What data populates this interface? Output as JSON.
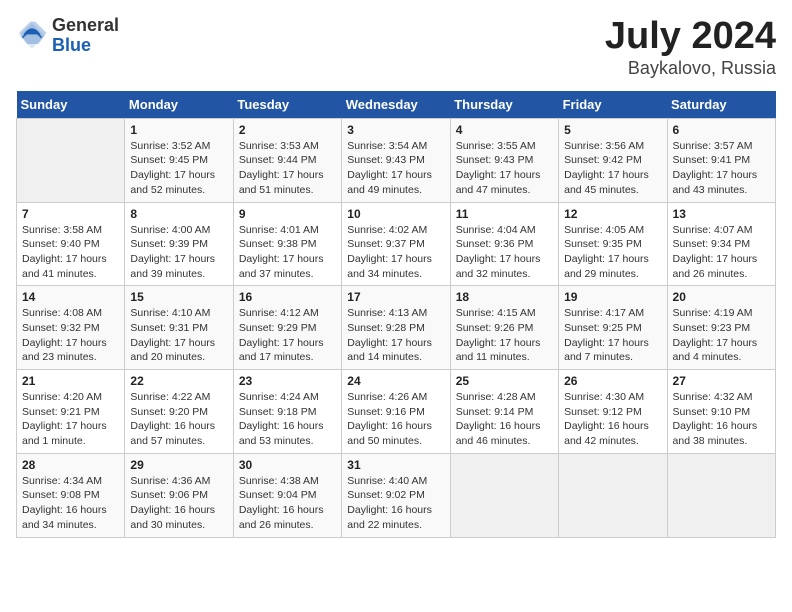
{
  "header": {
    "logo_general": "General",
    "logo_blue": "Blue",
    "month_year": "July 2024",
    "location": "Baykalovo, Russia"
  },
  "days_of_week": [
    "Sunday",
    "Monday",
    "Tuesday",
    "Wednesday",
    "Thursday",
    "Friday",
    "Saturday"
  ],
  "weeks": [
    [
      {
        "empty": true
      },
      {
        "day": "1",
        "sunrise": "Sunrise: 3:52 AM",
        "sunset": "Sunset: 9:45 PM",
        "daylight": "Daylight: 17 hours and 52 minutes."
      },
      {
        "day": "2",
        "sunrise": "Sunrise: 3:53 AM",
        "sunset": "Sunset: 9:44 PM",
        "daylight": "Daylight: 17 hours and 51 minutes."
      },
      {
        "day": "3",
        "sunrise": "Sunrise: 3:54 AM",
        "sunset": "Sunset: 9:43 PM",
        "daylight": "Daylight: 17 hours and 49 minutes."
      },
      {
        "day": "4",
        "sunrise": "Sunrise: 3:55 AM",
        "sunset": "Sunset: 9:43 PM",
        "daylight": "Daylight: 17 hours and 47 minutes."
      },
      {
        "day": "5",
        "sunrise": "Sunrise: 3:56 AM",
        "sunset": "Sunset: 9:42 PM",
        "daylight": "Daylight: 17 hours and 45 minutes."
      },
      {
        "day": "6",
        "sunrise": "Sunrise: 3:57 AM",
        "sunset": "Sunset: 9:41 PM",
        "daylight": "Daylight: 17 hours and 43 minutes."
      }
    ],
    [
      {
        "day": "7",
        "sunrise": "Sunrise: 3:58 AM",
        "sunset": "Sunset: 9:40 PM",
        "daylight": "Daylight: 17 hours and 41 minutes."
      },
      {
        "day": "8",
        "sunrise": "Sunrise: 4:00 AM",
        "sunset": "Sunset: 9:39 PM",
        "daylight": "Daylight: 17 hours and 39 minutes."
      },
      {
        "day": "9",
        "sunrise": "Sunrise: 4:01 AM",
        "sunset": "Sunset: 9:38 PM",
        "daylight": "Daylight: 17 hours and 37 minutes."
      },
      {
        "day": "10",
        "sunrise": "Sunrise: 4:02 AM",
        "sunset": "Sunset: 9:37 PM",
        "daylight": "Daylight: 17 hours and 34 minutes."
      },
      {
        "day": "11",
        "sunrise": "Sunrise: 4:04 AM",
        "sunset": "Sunset: 9:36 PM",
        "daylight": "Daylight: 17 hours and 32 minutes."
      },
      {
        "day": "12",
        "sunrise": "Sunrise: 4:05 AM",
        "sunset": "Sunset: 9:35 PM",
        "daylight": "Daylight: 17 hours and 29 minutes."
      },
      {
        "day": "13",
        "sunrise": "Sunrise: 4:07 AM",
        "sunset": "Sunset: 9:34 PM",
        "daylight": "Daylight: 17 hours and 26 minutes."
      }
    ],
    [
      {
        "day": "14",
        "sunrise": "Sunrise: 4:08 AM",
        "sunset": "Sunset: 9:32 PM",
        "daylight": "Daylight: 17 hours and 23 minutes."
      },
      {
        "day": "15",
        "sunrise": "Sunrise: 4:10 AM",
        "sunset": "Sunset: 9:31 PM",
        "daylight": "Daylight: 17 hours and 20 minutes."
      },
      {
        "day": "16",
        "sunrise": "Sunrise: 4:12 AM",
        "sunset": "Sunset: 9:29 PM",
        "daylight": "Daylight: 17 hours and 17 minutes."
      },
      {
        "day": "17",
        "sunrise": "Sunrise: 4:13 AM",
        "sunset": "Sunset: 9:28 PM",
        "daylight": "Daylight: 17 hours and 14 minutes."
      },
      {
        "day": "18",
        "sunrise": "Sunrise: 4:15 AM",
        "sunset": "Sunset: 9:26 PM",
        "daylight": "Daylight: 17 hours and 11 minutes."
      },
      {
        "day": "19",
        "sunrise": "Sunrise: 4:17 AM",
        "sunset": "Sunset: 9:25 PM",
        "daylight": "Daylight: 17 hours and 7 minutes."
      },
      {
        "day": "20",
        "sunrise": "Sunrise: 4:19 AM",
        "sunset": "Sunset: 9:23 PM",
        "daylight": "Daylight: 17 hours and 4 minutes."
      }
    ],
    [
      {
        "day": "21",
        "sunrise": "Sunrise: 4:20 AM",
        "sunset": "Sunset: 9:21 PM",
        "daylight": "Daylight: 17 hours and 1 minute."
      },
      {
        "day": "22",
        "sunrise": "Sunrise: 4:22 AM",
        "sunset": "Sunset: 9:20 PM",
        "daylight": "Daylight: 16 hours and 57 minutes."
      },
      {
        "day": "23",
        "sunrise": "Sunrise: 4:24 AM",
        "sunset": "Sunset: 9:18 PM",
        "daylight": "Daylight: 16 hours and 53 minutes."
      },
      {
        "day": "24",
        "sunrise": "Sunrise: 4:26 AM",
        "sunset": "Sunset: 9:16 PM",
        "daylight": "Daylight: 16 hours and 50 minutes."
      },
      {
        "day": "25",
        "sunrise": "Sunrise: 4:28 AM",
        "sunset": "Sunset: 9:14 PM",
        "daylight": "Daylight: 16 hours and 46 minutes."
      },
      {
        "day": "26",
        "sunrise": "Sunrise: 4:30 AM",
        "sunset": "Sunset: 9:12 PM",
        "daylight": "Daylight: 16 hours and 42 minutes."
      },
      {
        "day": "27",
        "sunrise": "Sunrise: 4:32 AM",
        "sunset": "Sunset: 9:10 PM",
        "daylight": "Daylight: 16 hours and 38 minutes."
      }
    ],
    [
      {
        "day": "28",
        "sunrise": "Sunrise: 4:34 AM",
        "sunset": "Sunset: 9:08 PM",
        "daylight": "Daylight: 16 hours and 34 minutes."
      },
      {
        "day": "29",
        "sunrise": "Sunrise: 4:36 AM",
        "sunset": "Sunset: 9:06 PM",
        "daylight": "Daylight: 16 hours and 30 minutes."
      },
      {
        "day": "30",
        "sunrise": "Sunrise: 4:38 AM",
        "sunset": "Sunset: 9:04 PM",
        "daylight": "Daylight: 16 hours and 26 minutes."
      },
      {
        "day": "31",
        "sunrise": "Sunrise: 4:40 AM",
        "sunset": "Sunset: 9:02 PM",
        "daylight": "Daylight: 16 hours and 22 minutes."
      },
      {
        "empty": true
      },
      {
        "empty": true
      },
      {
        "empty": true
      }
    ]
  ]
}
